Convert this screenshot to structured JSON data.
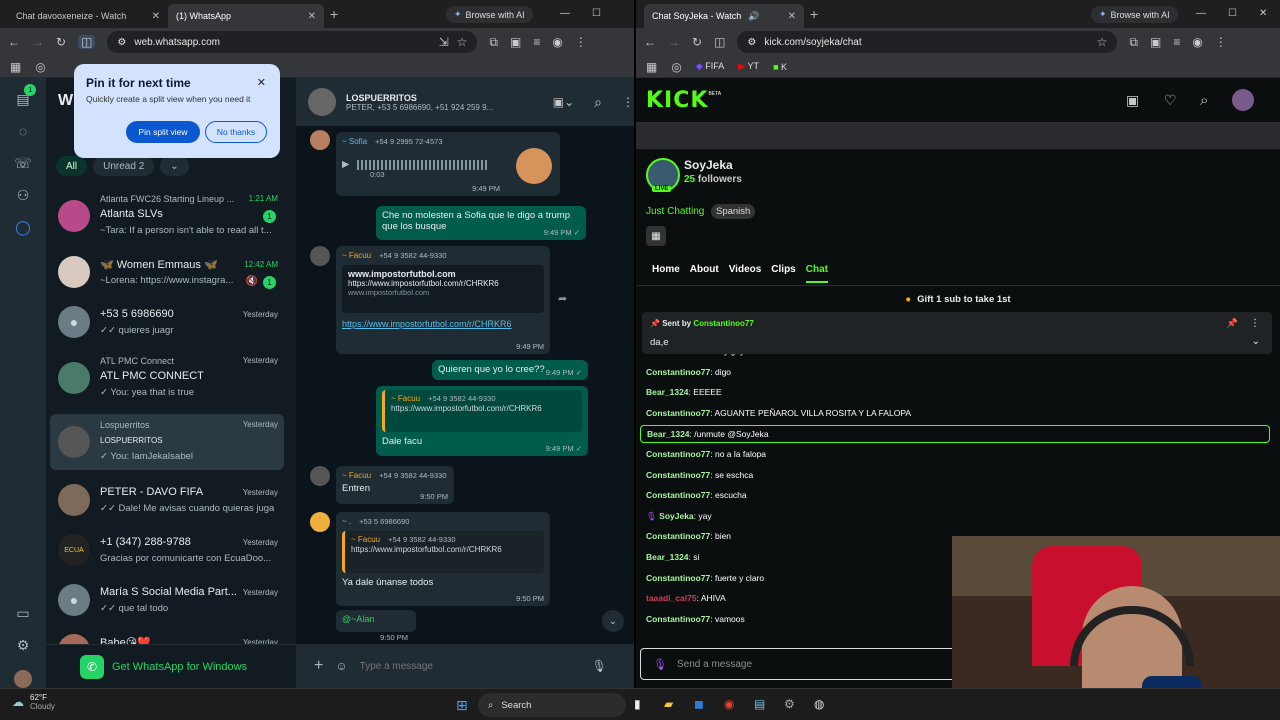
{
  "left_browser": {
    "tabs": [
      {
        "title": "Chat davooxeneize - Watch Liv",
        "icon": "kick-icon"
      },
      {
        "title": "(1) WhatsApp",
        "icon": "whatsapp-icon"
      }
    ],
    "browse_ai": "Browse with AI",
    "url": "web.whatsapp.com"
  },
  "right_browser": {
    "tab": "Chat SoyJeka - Watch Live",
    "browse_ai": "Browse with AI",
    "url": "kick.com/soyjeka/chat",
    "bookmarks": [
      "FIFA",
      "YT",
      "K"
    ]
  },
  "split_popup": {
    "title": "Pin it for next time",
    "desc": "Quickly create a split view when you need it",
    "primary": "Pin split view",
    "secondary": "No thanks"
  },
  "whatsapp": {
    "title": "WhatsApp",
    "rail_badge": "1",
    "filters": [
      "All",
      "Unread 2"
    ],
    "get_app": "Get WhatsApp for Windows",
    "chats": [
      {
        "top": "Atlanta FWC26 Starting Lineup ...",
        "name": "Atlanta SLVs",
        "msg": "~Tara: If a person isn't able to read all t...",
        "time": "1:21 AM",
        "badge": "1"
      },
      {
        "name": "🦋 Women Emmaus 🦋",
        "msg": "~Lorena: https://www.instagra...",
        "time": "12:42 AM",
        "badge": "1"
      },
      {
        "name": "+53 5 6986690",
        "msg": "✓✓ quieres juagr",
        "time": "Yesterday"
      },
      {
        "top": "ATL PMC Connect",
        "name": "ATL PMC CONNECT",
        "msg": "✓ You: yea that is true",
        "time": "Yesterday"
      },
      {
        "top": "Lospuerritos",
        "name": "LOSPUERRITOS",
        "msg": "✓ You: IamJekaIsabel",
        "time": "Yesterday"
      },
      {
        "name": "PETER - DAVO FIFA",
        "msg": "✓✓ Dale! Me avisas cuando quieras jugar",
        "time": "Yesterday"
      },
      {
        "name": "+1 (347) 288-9788",
        "msg": "Gracias por comunicarte con EcuaDoo...",
        "time": "Yesterday"
      },
      {
        "name": "María S Social Media Part...",
        "msg": "✓✓ que tal todo",
        "time": "Yesterday"
      },
      {
        "name": "Babe😘❤️",
        "msg": "",
        "time": "Yesterday"
      }
    ],
    "conversation": {
      "name": "LOSPUERRITOS",
      "members": "PETER, +53 5 6986690, +51 924 259 9...",
      "placeholder": "Type a message",
      "messages": [
        {
          "sender": "~ Sofia",
          "phone": "+54 9 2995 72-4573",
          "audio_time": "0:03",
          "time": "9:49 PM"
        },
        {
          "text": "Che no molesten a Sofia que le digo a trump que los busque",
          "time": "9:49 PM"
        },
        {
          "sender": "~ Facuu",
          "phone": "+54 9 3582 44-9330",
          "preview_title": "www.impostorfutbol.com",
          "preview_url": "https://www.impostorfutbol.com/r/CHRKR6",
          "preview_domain": "www.impostorfutbol.com",
          "link": "https://www.impostorfutbol.com/r/CHRKR6",
          "time": "9:49 PM"
        },
        {
          "text": "Quieren que yo lo cree??",
          "time": "9:49 PM"
        },
        {
          "quote_sender": "~ Facuu",
          "quote_phone": "+54 9 3582 44-9330",
          "quote_text": "https://www.impostorfutbol.com/r/CHRKR6",
          "text": "Dale facu",
          "time": "9:49 PM"
        },
        {
          "sender": "~ Facuu",
          "phone": "+54 9 3582 44-9330",
          "text": "Entren",
          "time": "9:50 PM"
        },
        {
          "sender": "~ .",
          "phone": "+53 5 6986690",
          "quote_sender": "~ Facuu",
          "quote_phone": "+54 9 3582 44-9330",
          "quote_text": "https://www.impostorfutbol.com/r/CHRKR6",
          "text": "Ya dale únanse todos",
          "time": "9:50 PM"
        },
        {
          "text": "@~Alan",
          "time": "9:50 PM"
        }
      ]
    }
  },
  "kick": {
    "logo": "KICK",
    "beta": "BETA",
    "channel": "SoyJeka",
    "followers_count": "25",
    "followers_label": "followers",
    "live": "LIVE",
    "category": "Just Chatting",
    "language": "Spanish",
    "tabs": [
      "Home",
      "About",
      "Videos",
      "Clips",
      "Chat"
    ],
    "gift": "Gift 1 sub to take 1st",
    "pinned_by_label": "Sent by",
    "pinned_by": "Constantinoo77",
    "pinned_text": "da,e",
    "composer_placeholder": "Send a message",
    "messages": [
      {
        "user": "Constantinoo77",
        "text": "soy gay",
        "color": "#a6f59f"
      },
      {
        "user": "Constantinoo77",
        "text": "digo",
        "color": "#a6f59f"
      },
      {
        "user": "Bear_1324",
        "text": "EEEEE",
        "color": "#a6f59f"
      },
      {
        "user": "Constantinoo77",
        "text": "AGUANTE PEÑAROL VILLA ROSITA Y LA FALOPA",
        "color": "#a6f59f"
      },
      {
        "user": "Bear_1324",
        "text": "/unmute @SoyJeka",
        "color": "#a6f59f"
      },
      {
        "user": "Constantinoo77",
        "text": "no a la falopa",
        "color": "#a6f59f"
      },
      {
        "user": "Constantinoo77",
        "text": "se eschca",
        "color": "#a6f59f"
      },
      {
        "user": "Constantinoo77",
        "text": "escucha",
        "color": "#a6f59f"
      },
      {
        "user": "SoyJeka",
        "text": "yay",
        "color": "#a6f59f"
      },
      {
        "user": "Constantinoo77",
        "text": "bien",
        "color": "#a6f59f"
      },
      {
        "user": "Bear_1324",
        "text": "si",
        "color": "#a6f59f"
      },
      {
        "user": "Constantinoo77",
        "text": "fuerte y claro",
        "color": "#a6f59f"
      },
      {
        "user": "taaadi_cal75",
        "text": "AHIVA",
        "color": "#d43a55"
      },
      {
        "user": "Constantinoo77",
        "text": "vamoos",
        "color": "#a6f59f"
      }
    ]
  },
  "taskbar": {
    "temp": "62°F",
    "weather": "Cloudy",
    "search": "Search"
  }
}
